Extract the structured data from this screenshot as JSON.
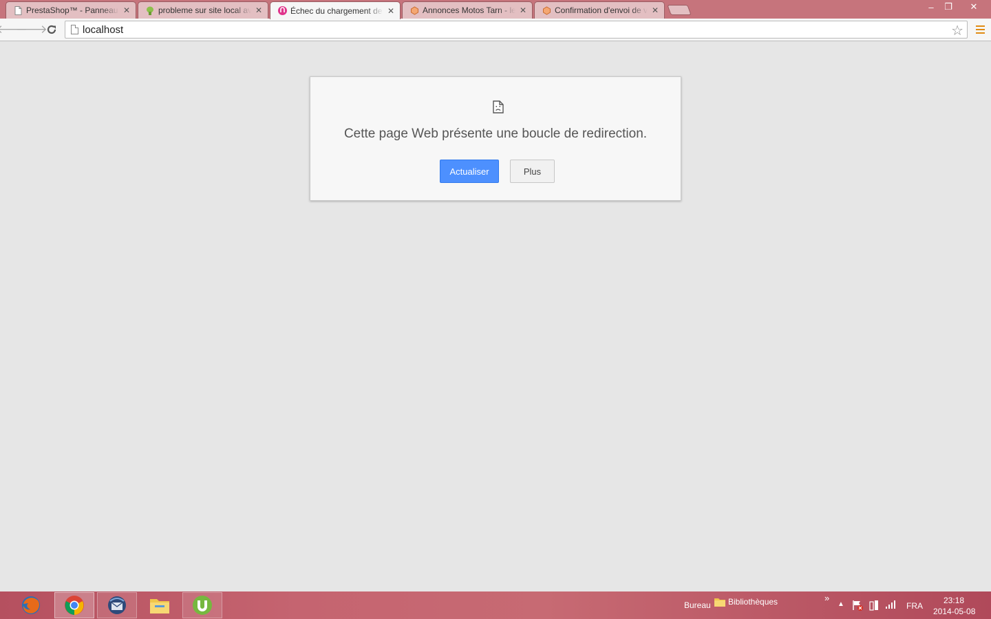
{
  "browser": {
    "tabs": [
      {
        "title": "PrestaShop™ - Panneau d'administration",
        "favicon": "page-icon",
        "active": false
      },
      {
        "title": "probleme sur site local avec",
        "favicon": "prestashop-icon",
        "active": false
      },
      {
        "title": "Échec du chargement de la page",
        "favicon": "magnet-icon",
        "active": true
      },
      {
        "title": "Annonces Motos Tarn - le bon coin",
        "favicon": "leboncoin-icon",
        "active": false
      },
      {
        "title": "Confirmation d'envoi de votre annonce",
        "favicon": "leboncoin-icon",
        "active": false
      }
    ],
    "address": "localhost"
  },
  "error": {
    "message": "Cette page Web présente une boucle de redirection.",
    "primary_button": "Actualiser",
    "secondary_button": "Plus"
  },
  "taskbar": {
    "apps": [
      "firefox-icon",
      "chrome-icon",
      "thunderbird-icon",
      "file-explorer-icon",
      "utorrent-icon"
    ],
    "toolbar_label": "Bureau",
    "libraries_label": "Bibliothèques",
    "overflow": "»",
    "language": "FRA",
    "time": "23:18",
    "date": "2014-05-08"
  },
  "colors": {
    "accent": "#4d90fe",
    "window_frame": "#c6747c",
    "page_background": "#e6e6e6"
  }
}
